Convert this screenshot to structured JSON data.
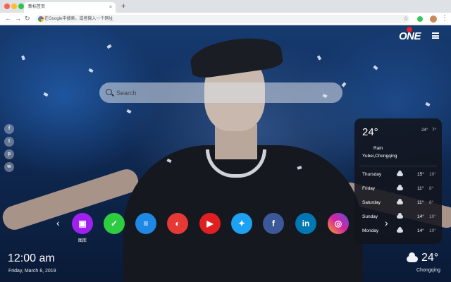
{
  "browser": {
    "tab_title": "新标签页",
    "tab_close": "×",
    "new_tab": "+",
    "address": "在Google中搜索，或者输入一个网址"
  },
  "search": {
    "placeholder": "Search"
  },
  "logo": {
    "text": "ONE"
  },
  "social_icons": [
    {
      "icon": "facebook-icon",
      "glyph": "f"
    },
    {
      "icon": "twitter-icon",
      "glyph": "t"
    },
    {
      "icon": "pinterest-icon",
      "glyph": "p"
    },
    {
      "icon": "wechat-icon",
      "glyph": "w"
    }
  ],
  "weather_widget": {
    "temp": "24°",
    "high": "24°",
    "low": "7°",
    "condition": "Rain",
    "location": "Yubei,Chongqing",
    "forecast": [
      {
        "day": "Thursday",
        "hi": "15°",
        "lo": "10°"
      },
      {
        "day": "Friday",
        "hi": "11°",
        "lo": "8°"
      },
      {
        "day": "Saturday",
        "hi": "11°",
        "lo": "8°"
      },
      {
        "day": "Sunday",
        "hi": "14°",
        "lo": "10°"
      },
      {
        "day": "Monday",
        "hi": "14°",
        "lo": "10°"
      }
    ]
  },
  "dock": {
    "items": [
      {
        "icon": "gallery-icon",
        "label": "图库",
        "color": "#a020f0"
      },
      {
        "icon": "todo-icon",
        "label": "",
        "color": "#2ecc40"
      },
      {
        "icon": "notes-icon",
        "label": "",
        "color": "#1e88e5"
      },
      {
        "icon": "games-icon",
        "label": "",
        "color": "#e53935"
      },
      {
        "icon": "youtube-icon",
        "label": "",
        "color": "#e02020"
      },
      {
        "icon": "twitter-icon",
        "label": "",
        "color": "#1da1f2"
      },
      {
        "icon": "facebook-icon",
        "label": "",
        "color": "#3b5998"
      },
      {
        "icon": "linkedin-icon",
        "label": "",
        "color": "#0077b5"
      },
      {
        "icon": "instagram-icon",
        "label": "",
        "color": "#d6249f"
      }
    ]
  },
  "clock": {
    "time": "12:00 am",
    "date": "Friday, March 8, 2019"
  },
  "corner_weather": {
    "temp": "24°",
    "location": "Chongqing"
  }
}
